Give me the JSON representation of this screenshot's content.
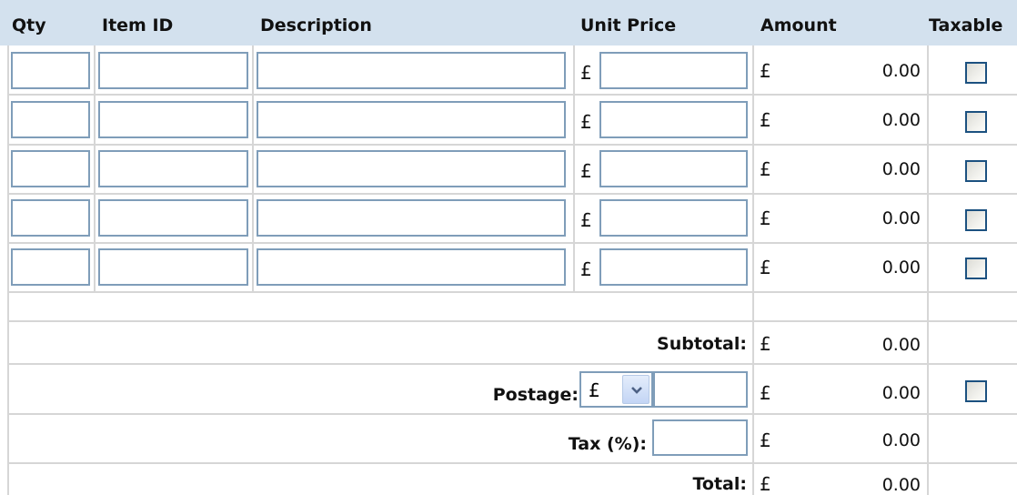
{
  "headers": {
    "qty": "Qty",
    "item_id": "Item ID",
    "description": "Description",
    "unit_price": "Unit Price",
    "amount": "Amount",
    "taxable": "Taxable"
  },
  "currency_symbol": "£",
  "line_items": [
    {
      "qty": "",
      "item_id": "",
      "description": "",
      "unit_price": "",
      "amount": "0.00",
      "taxable": false
    },
    {
      "qty": "",
      "item_id": "",
      "description": "",
      "unit_price": "",
      "amount": "0.00",
      "taxable": false
    },
    {
      "qty": "",
      "item_id": "",
      "description": "",
      "unit_price": "",
      "amount": "0.00",
      "taxable": false
    },
    {
      "qty": "",
      "item_id": "",
      "description": "",
      "unit_price": "",
      "amount": "0.00",
      "taxable": false
    },
    {
      "qty": "",
      "item_id": "",
      "description": "",
      "unit_price": "",
      "amount": "0.00",
      "taxable": false
    }
  ],
  "totals": {
    "subtotal_label": "Subtotal:",
    "subtotal_amount": "0.00",
    "postage_label": "Postage:",
    "postage_currency": "£",
    "postage_value": "",
    "postage_amount": "0.00",
    "postage_taxable": false,
    "tax_label": "Tax (%):",
    "tax_value": "",
    "tax_amount": "0.00",
    "total_label": "Total:",
    "total_amount": "0.00"
  },
  "colors": {
    "header_bg": "#d3e1ee",
    "input_border": "#7f9db9",
    "grid_line": "#d6d6d6",
    "checkbox_border": "#1c5180"
  }
}
